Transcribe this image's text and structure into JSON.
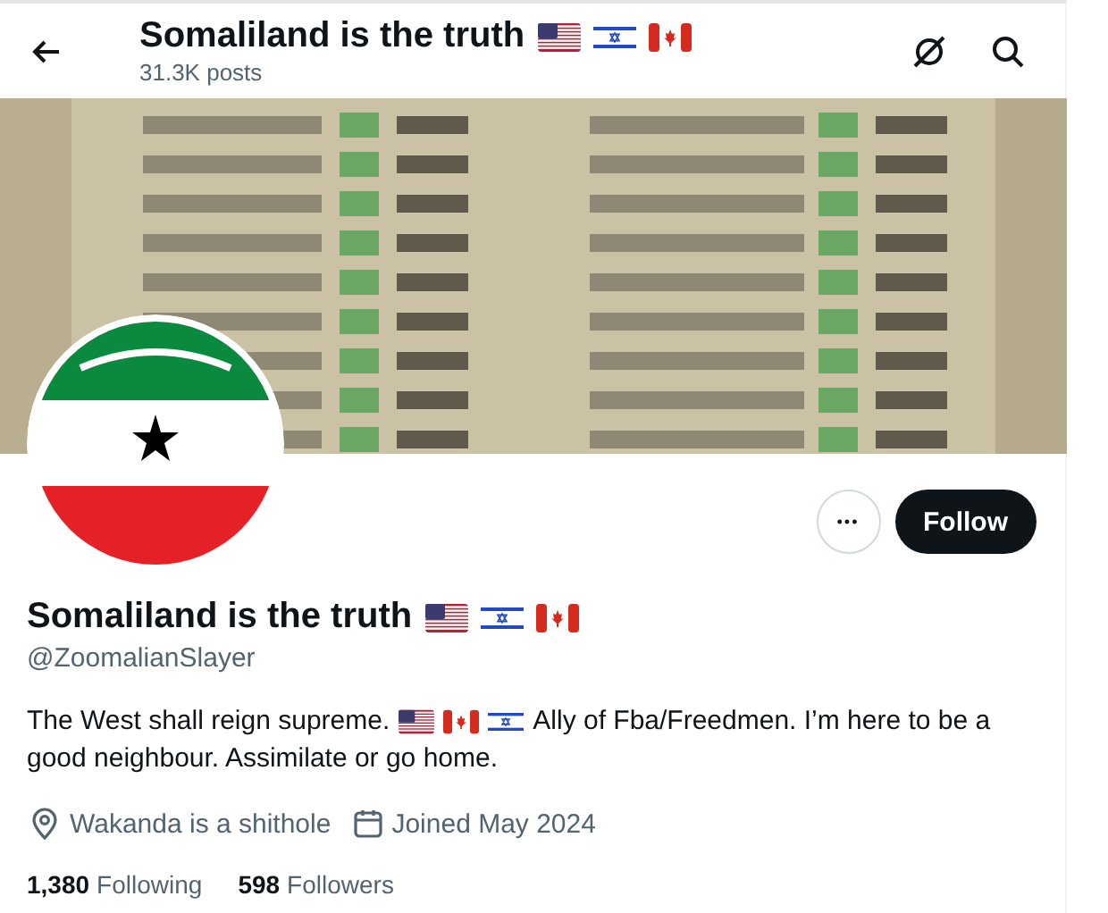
{
  "header": {
    "title": "Somaliland is the truth",
    "title_flags": [
      {
        "kind": "us_flag"
      },
      {
        "kind": "israel_flag"
      },
      {
        "kind": "canada_flag"
      }
    ],
    "posts": "31.3K posts"
  },
  "actions": {
    "more": "•••",
    "follow": "Follow"
  },
  "profile": {
    "name": "Somaliland is the truth",
    "name_flags": [
      {
        "kind": "us_flag"
      },
      {
        "kind": "israel_flag"
      },
      {
        "kind": "canada_flag"
      }
    ],
    "handle": "@ZoomalianSlayer",
    "bio": [
      {
        "kind": "text",
        "text": "The West shall reign supreme."
      },
      {
        "kind": "us_flag"
      },
      {
        "kind": "canada_flag"
      },
      {
        "kind": "israel_flag"
      },
      {
        "kind": "text",
        "text": "Ally of Fba/Freedmen. I’m here to be a"
      },
      {
        "kind": "text",
        "text": "good neighbour. Assimilate or go home."
      }
    ],
    "location": "Wakanda is a shithole",
    "joined": "Joined May 2024"
  },
  "stats": [
    {
      "count": "1,380",
      "label": "Following"
    },
    {
      "count": "598",
      "label": "Followers"
    }
  ]
}
